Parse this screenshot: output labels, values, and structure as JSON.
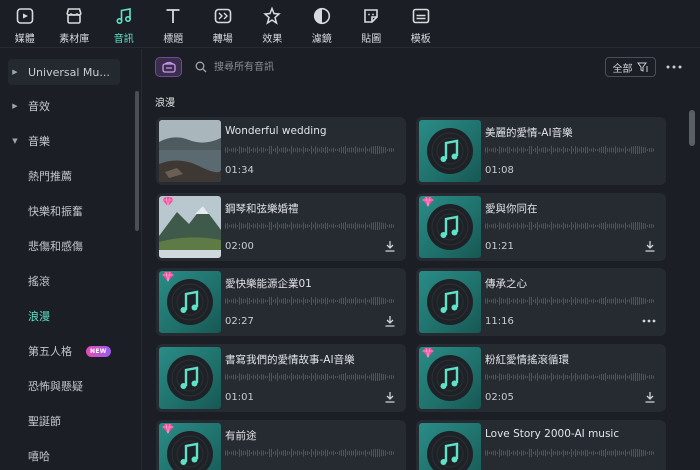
{
  "toolbar": {
    "items": [
      {
        "label": "媒體",
        "icon": "media-icon"
      },
      {
        "label": "素材庫",
        "icon": "store-icon"
      },
      {
        "label": "音訊",
        "icon": "music-note-icon"
      },
      {
        "label": "標題",
        "icon": "text-icon"
      },
      {
        "label": "轉場",
        "icon": "transition-icon"
      },
      {
        "label": "效果",
        "icon": "effects-icon"
      },
      {
        "label": "濾鏡",
        "icon": "filter-icon"
      },
      {
        "label": "貼圖",
        "icon": "sticker-icon"
      },
      {
        "label": "模板",
        "icon": "template-icon"
      }
    ],
    "active_index": 2
  },
  "sidebar": {
    "groups": [
      {
        "label": "Universal Mu..."
      },
      {
        "label": "音效"
      },
      {
        "label": "音樂"
      }
    ],
    "subitems": [
      {
        "label": "熱門推薦"
      },
      {
        "label": "快樂和振奮"
      },
      {
        "label": "悲傷和感傷"
      },
      {
        "label": "搖滾"
      },
      {
        "label": "浪漫"
      },
      {
        "label": "第五人格",
        "badge": "NEW"
      },
      {
        "label": "恐怖與懸疑"
      },
      {
        "label": "聖誕節"
      },
      {
        "label": "嘻哈"
      }
    ],
    "active_sub": 4
  },
  "search": {
    "placeholder": "搜尋所有音訊",
    "filter_label": "全部"
  },
  "section": {
    "title": "浪漫"
  },
  "tracks": [
    {
      "title": "Wonderful wedding",
      "duration": "01:34",
      "thumb": "photo-lake",
      "premium": false,
      "action": "none"
    },
    {
      "title": "美麗的愛情-AI音樂",
      "duration": "01:08",
      "thumb": "disc",
      "premium": false,
      "action": "none"
    },
    {
      "title": "鋼琴和弦樂婚禮",
      "duration": "02:00",
      "thumb": "photo-mountain",
      "premium": true,
      "action": "download"
    },
    {
      "title": "愛與你同在",
      "duration": "01:21",
      "thumb": "disc",
      "premium": true,
      "action": "download"
    },
    {
      "title": "愛快樂能源企業01",
      "duration": "02:27",
      "thumb": "disc",
      "premium": true,
      "action": "download"
    },
    {
      "title": "傳承之心",
      "duration": "11:16",
      "thumb": "disc",
      "premium": false,
      "action": "more"
    },
    {
      "title": "書寫我們的愛情故事-AI音樂",
      "duration": "01:01",
      "thumb": "disc",
      "premium": false,
      "action": "download"
    },
    {
      "title": "粉紅愛情搖滾循環",
      "duration": "02:05",
      "thumb": "disc",
      "premium": true,
      "action": "download"
    },
    {
      "title": "有前途",
      "duration": "",
      "thumb": "disc",
      "premium": true,
      "action": "none"
    },
    {
      "title": "Love Story 2000-AI music",
      "duration": "",
      "thumb": "disc",
      "premium": false,
      "action": "none"
    }
  ],
  "colors": {
    "accent": "#5fe3c8",
    "card": "#262a31",
    "background": "#1b1e24"
  }
}
